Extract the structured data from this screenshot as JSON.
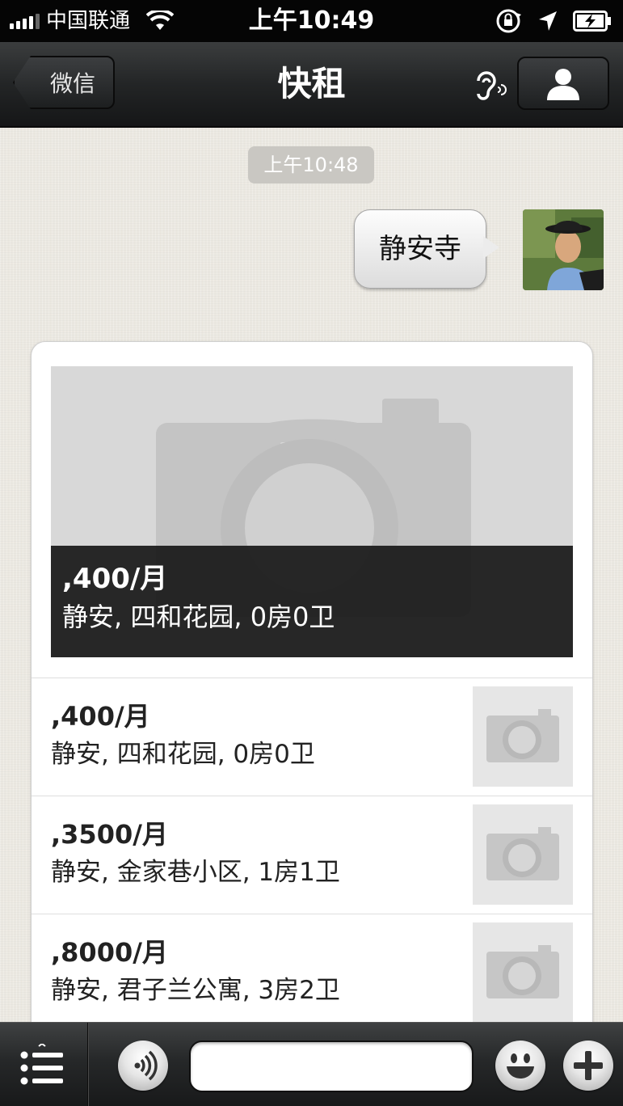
{
  "status_bar": {
    "carrier": "中国联通",
    "time": "上午10:49"
  },
  "nav": {
    "back_label": "微信",
    "title": "快租"
  },
  "chat": {
    "timestamp": "上午10:48",
    "outgoing_message": "静安寺"
  },
  "listing_card": {
    "featured": {
      "price": ",400/月",
      "description": "静安, 四和花园, 0房0卫"
    },
    "items": [
      {
        "price": ",400/月",
        "description": "静安, 四和花园, 0房0卫"
      },
      {
        "price": ",3500/月",
        "description": "静安, 金家巷小区, 1房1卫"
      },
      {
        "price": ",8000/月",
        "description": "静安, 君子兰公寓, 3房2卫"
      }
    ]
  },
  "toolbar": {
    "input_value": "",
    "icons": [
      "menu-icon",
      "voice-icon",
      "emoji-icon",
      "plus-icon"
    ]
  },
  "colors": {
    "nav_bg": "#232526",
    "status_bg": "#050505",
    "card_caption_bg": "#191919"
  }
}
